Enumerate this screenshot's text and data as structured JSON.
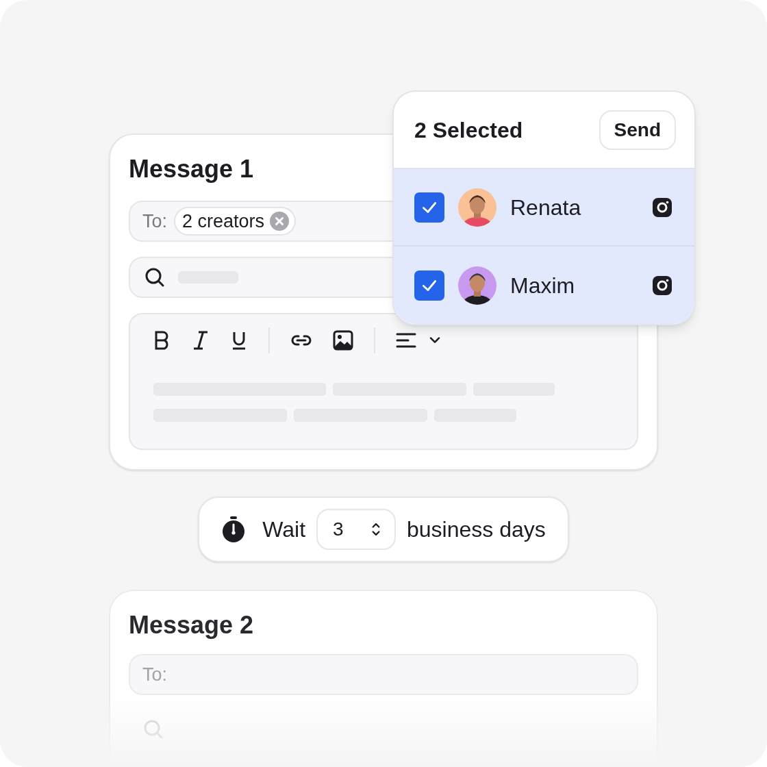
{
  "message_1": {
    "title": "Message 1",
    "to_label": "To:",
    "recipient_chip": "2 creators"
  },
  "selection_popover": {
    "title": "2 Selected",
    "send_button": "Send",
    "creators": [
      {
        "name": "Renata",
        "checked": true
      },
      {
        "name": "Maxim",
        "checked": true
      }
    ]
  },
  "wait_step": {
    "label": "Wait",
    "value": "3",
    "unit": "business days"
  },
  "message_2": {
    "title": "Message 2",
    "to_label": "To:"
  }
}
